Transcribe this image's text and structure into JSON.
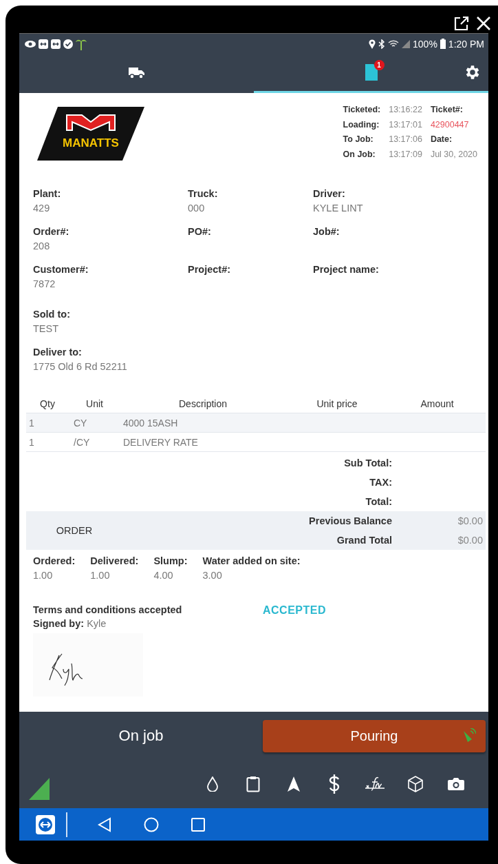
{
  "status_bar": {
    "battery": "100%",
    "time": "1:20 PM"
  },
  "tabs": [
    {
      "selected": false
    },
    {
      "selected": true,
      "badge": "1"
    }
  ],
  "ticket": {
    "logo_text": "MANATTS",
    "times": [
      {
        "label": "Ticketed:",
        "value": "13:16:22"
      },
      {
        "label": "Loading:",
        "value": "13:17:01"
      },
      {
        "label": "To Job:",
        "value": "13:17:06"
      },
      {
        "label": "On Job:",
        "value": "13:17:09"
      }
    ],
    "ticket_label": "Ticket#:",
    "ticket_number": "42900447",
    "date_label": "Date:",
    "date": "Jul 30, 2020"
  },
  "fields": [
    [
      {
        "label": "Plant:",
        "value": "429"
      },
      {
        "label": "Truck:",
        "value": "000"
      },
      {
        "label": "Driver:",
        "value": "KYLE LINT"
      }
    ],
    [
      {
        "label": "Order#:",
        "value": "208"
      },
      {
        "label": "PO#:"
      },
      {
        "label": "Job#:"
      }
    ],
    [
      {
        "label": "Customer#:",
        "value": "7872"
      },
      {
        "label": "Project#:"
      },
      {
        "label": "Project name:"
      }
    ]
  ],
  "parties": [
    {
      "label": "Sold to:",
      "value": "TEST"
    },
    {
      "label": "Deliver to:",
      "value": "1775 Old 6 Rd 52211"
    }
  ],
  "items": {
    "columns": [
      "Qty",
      "Unit",
      "Description",
      "Unit price",
      "Amount"
    ],
    "rows": [
      [
        "1",
        "CY",
        "4000 15ASH"
      ],
      [
        "1",
        "/CY",
        "DELIVERY RATE"
      ]
    ]
  },
  "totals": [
    "Sub Total:",
    "TAX:",
    "Total:"
  ],
  "balance": {
    "order_label": "ORDER",
    "rows": [
      {
        "label": "Previous Balance",
        "value": "$0.00"
      },
      {
        "label": "Grand Total",
        "value": "$0.00"
      }
    ]
  },
  "measures": [
    {
      "label": "Ordered:",
      "value": "1.00"
    },
    {
      "label": "Delivered:",
      "value": "1.00"
    },
    {
      "label": "Slump:",
      "value": "4.00"
    },
    {
      "label": "Water added on site:",
      "value": "3.00"
    }
  ],
  "terms": {
    "text": "Terms and conditions accepted",
    "signed_label": "Signed by:",
    "signer": "Kyle",
    "status": "ACCEPTED"
  },
  "footer": {
    "status": "On job",
    "action": "Pouring"
  }
}
